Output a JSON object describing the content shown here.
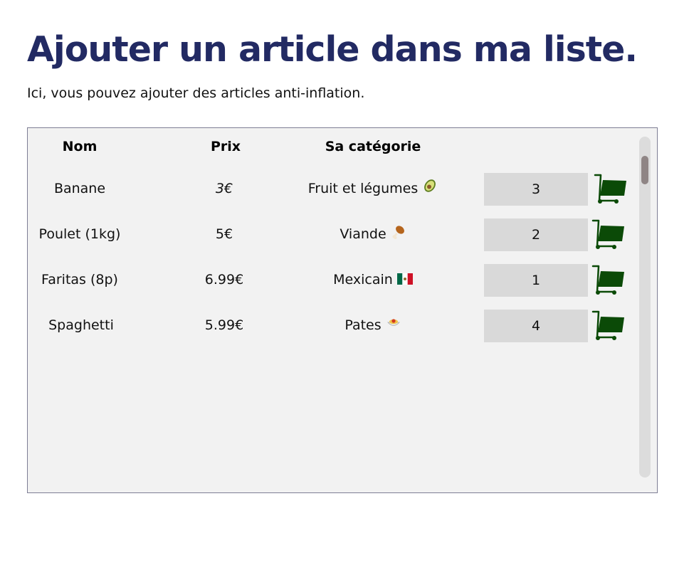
{
  "page": {
    "title": "Ajouter un article dans ma liste.",
    "subtitle": "Ici, vous pouvez ajouter des articles anti-inflation."
  },
  "table": {
    "headers": {
      "name": "Nom",
      "price": "Prix",
      "category": "Sa catégorie"
    },
    "rows": [
      {
        "name": "Banane",
        "price": "3€",
        "category": "Fruit et légumes",
        "category_icon": "avocado-icon",
        "quantity": "3"
      },
      {
        "name": "Poulet (1kg)",
        "price": "5€",
        "category": "Viande",
        "category_icon": "poultry-leg-icon",
        "quantity": "2"
      },
      {
        "name": "Faritas (8p)",
        "price": "6.99€",
        "category": "Mexicain",
        "category_icon": "mexico-flag-icon",
        "quantity": "1"
      },
      {
        "name": "Spaghetti",
        "price": "5.99€",
        "category": "Pates",
        "category_icon": "spaghetti-icon",
        "quantity": "4"
      }
    ],
    "add_button_icon": "shopping-cart-icon"
  },
  "colors": {
    "title": "#222a63",
    "panel_background": "#f2f2f2",
    "quantity_background": "#d9d9d9",
    "cart_icon": "#0b4a07"
  }
}
